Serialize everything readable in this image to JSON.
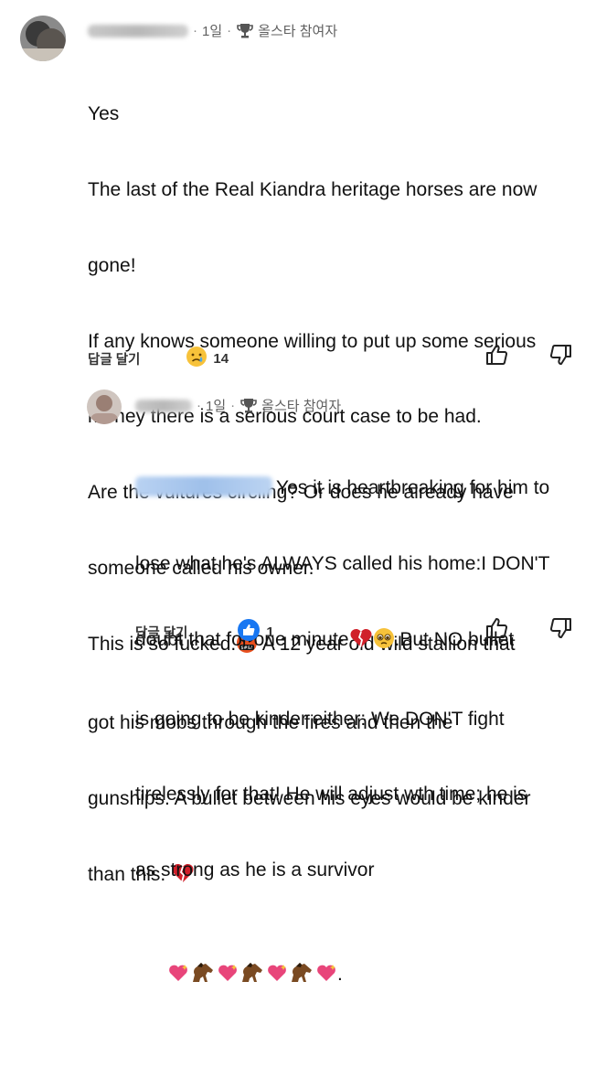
{
  "comments": [
    {
      "time": "1일",
      "badge": "올스타 참여자",
      "lines": [
        "Yes",
        "The last of the Real Kiandra heritage horses are now",
        "gone!",
        "If any knows someone willing to put up some serious",
        "money there is a serious court case to be had.",
        "Are the vultures circling? Or does he already have",
        "someone called his owner.",
        "This is so fucked.",
        " A 12 year old wild stallion that",
        "got his mobs through the fires and then the",
        "gunships. A bullet between his eyes would be kinder",
        "than this. "
      ],
      "reply_label": "답글 달기",
      "reaction_count": "14",
      "reaction_icon": "sad-tear-emoji",
      "like_icon": "thumbs-up-icon",
      "dislike_icon": "thumbs-down-icon"
    },
    {
      "time": "1일",
      "badge": "올스타 참여자",
      "lines": [
        "Yes it is heartbreaking for him to",
        "lose what he's ALWAYS called his home:I DON'T",
        "doubt that for one minute",
        ".But NO bullet",
        "is going to be kinder either: We DON'T fight",
        "tirelessly for that! He will adjust wth time; he is",
        "as strong as he is a survivor",
        "."
      ],
      "reply_label": "답글 달기",
      "reaction_count": "1",
      "reaction_icon": "blue-like-icon",
      "like_icon": "thumbs-up-icon",
      "dislike_icon": "thumbs-down-icon"
    }
  ],
  "colors": {
    "text": "#111111",
    "meta": "#606060",
    "mention": "#9fc0ea",
    "like_blue": "#1877f2"
  }
}
